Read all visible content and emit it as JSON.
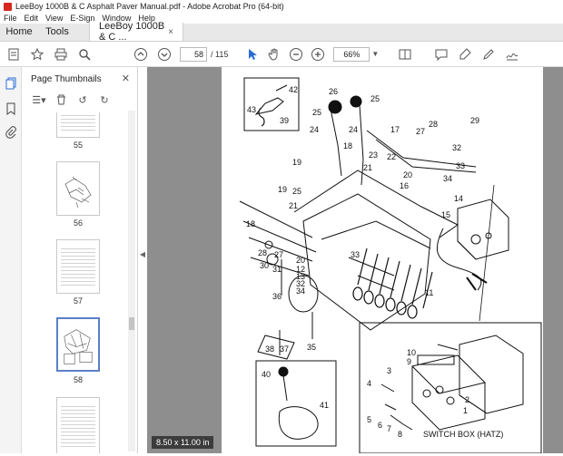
{
  "window": {
    "title": "LeeBoy 1000B & C Asphalt Paver Manual.pdf - Adobe Acrobat Pro (64-bit)"
  },
  "menu": [
    "File",
    "Edit",
    "View",
    "E-Sign",
    "Window",
    "Help"
  ],
  "tabs": {
    "home": "Home",
    "tools": "Tools",
    "doc": "LeeBoy 1000B & C ...",
    "doc_close": "×"
  },
  "toolbar": {
    "page_current": "58",
    "page_of": "/ 115",
    "zoom": "66%"
  },
  "sidebar": {
    "title": "Page Thumbnails",
    "thumbs": [
      {
        "label": "55"
      },
      {
        "label": "56"
      },
      {
        "label": "57"
      },
      {
        "label": "58"
      }
    ]
  },
  "document": {
    "size_badge": "8.50 x 11.00 in",
    "part_numbers": [
      "42",
      "43",
      "39",
      "26",
      "25",
      "25",
      "24",
      "24",
      "18",
      "17",
      "28",
      "27",
      "29",
      "32",
      "33",
      "19",
      "23",
      "22",
      "21",
      "20",
      "16",
      "34",
      "14",
      "15",
      "25",
      "19",
      "21",
      "18",
      "28",
      "30",
      "31",
      "27",
      "20",
      "12",
      "13",
      "32",
      "34",
      "33",
      "36",
      "11",
      "35",
      "38",
      "37",
      "40",
      "41",
      "10",
      "9",
      "3",
      "4",
      "5",
      "6",
      "7",
      "8",
      "2",
      "1"
    ],
    "switch_box_label": "SWITCH BOX (HATZ)"
  },
  "icons": {
    "star": "star-icon",
    "print": "print-icon",
    "search": "search-icon",
    "up": "page-up-icon",
    "down": "page-down-icon",
    "cursor": "select-cursor-icon",
    "hand": "hand-icon",
    "zoom_out": "zoom-out-icon",
    "zoom_in": "zoom-in-icon"
  },
  "colors": {
    "accent": "#2b6bd6",
    "app_red": "#d7261e",
    "viewer_bg": "#8e8e8e"
  }
}
